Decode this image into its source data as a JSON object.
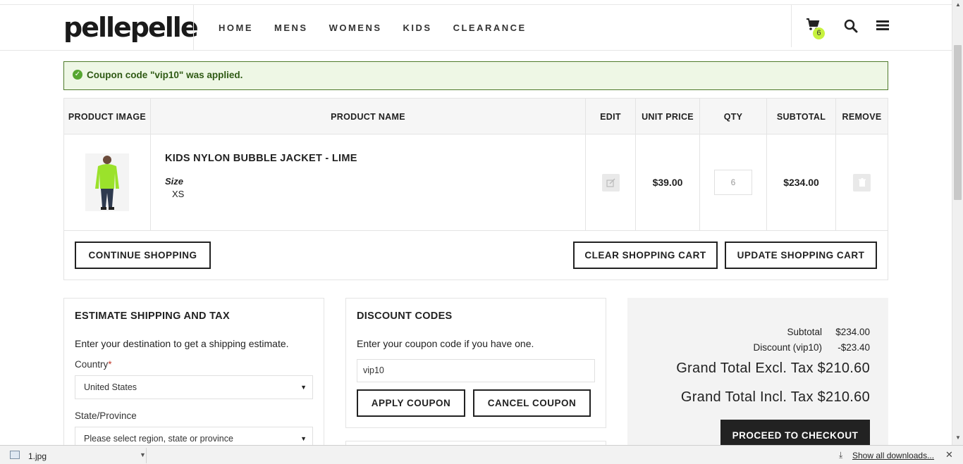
{
  "header": {
    "brand": "pellepelle",
    "nav": [
      "HOME",
      "MENS",
      "WOMENS",
      "KIDS",
      "CLEARANCE"
    ],
    "cart_count": "6"
  },
  "message": {
    "text": "Coupon code \"vip10\" was applied."
  },
  "cart": {
    "columns": {
      "image": "PRODUCT IMAGE",
      "name": "PRODUCT NAME",
      "edit": "EDIT",
      "unit_price": "UNIT PRICE",
      "qty": "QTY",
      "subtotal": "SUBTOTAL",
      "remove": "REMOVE"
    },
    "item": {
      "name": "KIDS NYLON BUBBLE JACKET - LIME",
      "size_label": "Size",
      "size_value": "XS",
      "unit_price": "$39.00",
      "qty": "6",
      "subtotal": "$234.00"
    },
    "buttons": {
      "continue": "CONTINUE SHOPPING",
      "clear": "CLEAR SHOPPING CART",
      "update": "UPDATE SHOPPING CART"
    }
  },
  "shipping": {
    "title": "ESTIMATE SHIPPING AND TAX",
    "desc": "Enter your destination to get a shipping estimate.",
    "country_label": "Country",
    "required_mark": "*",
    "country_value": "United States",
    "state_label": "State/Province",
    "state_value": "Please select region, state or province"
  },
  "discount": {
    "title": "DISCOUNT CODES",
    "desc": "Enter your coupon code if you have one.",
    "code_value": "vip10",
    "apply": "APPLY COUPON",
    "cancel": "CANCEL COUPON"
  },
  "totals": {
    "subtotal_label": "Subtotal",
    "subtotal_value": "$234.00",
    "discount_label": "Discount (vip10)",
    "discount_value": "-$23.40",
    "grand_excl": "Grand Total Excl. Tax $210.60",
    "grand_incl": "Grand Total Incl. Tax $210.60",
    "checkout": "PROCEED TO CHECKOUT"
  },
  "downloads": {
    "file": "1.jpg",
    "show_all": "Show all downloads..."
  },
  "colors": {
    "accent_badge": "#c7f23e",
    "success_border": "#4e7a2a",
    "success_bg": "#eef7e5",
    "product_lime": "#9be22b"
  }
}
